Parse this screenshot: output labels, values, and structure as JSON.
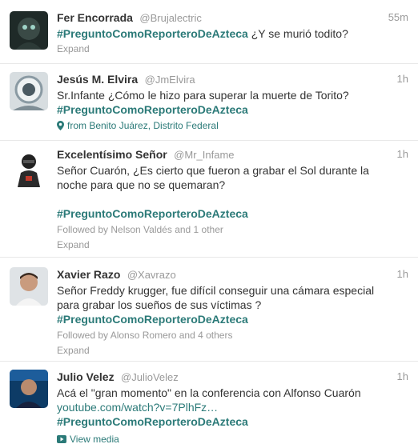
{
  "tweets": [
    {
      "fullname": "Fer Encorrada",
      "username": "@Brujalectric",
      "time": "55m",
      "hashtag": "#PreguntoComoReporteroDeAzteca",
      "text_after": " ¿Y se murió todito?",
      "action": "Expand"
    },
    {
      "fullname": "Jesús M. Elvira",
      "username": "@JmElvira",
      "time": "1h",
      "text_line1": "Sr.Infante ¿Cómo le hizo para superar la muerte de Torito?",
      "hashtag": "#PreguntoComoReporteroDeAzteca",
      "geo": "from Benito Juárez, Distrito Federal"
    },
    {
      "fullname": "Excelentísimo Señor",
      "username": "@Mr_Infame",
      "time": "1h",
      "text_line1": "Señor Cuarón, ¿Es cierto que fueron a grabar el Sol durante la",
      "text_line2": "noche para que no se quemaran?",
      "hashtag": "#PreguntoComoReporteroDeAzteca",
      "followed_by": "Followed by Nelson Valdés and 1 other",
      "action": "Expand"
    },
    {
      "fullname": "Xavier Razo",
      "username": "@Xavrazo",
      "time": "1h",
      "text_line1": "Señor Freddy krugger, fue difícil conseguir una cámara especial",
      "text_line2": "para grabar los sueños de sus víctimas ?",
      "hashtag": "#PreguntoComoReporteroDeAzteca",
      "followed_by": "Followed by Alonso Romero and 4 others",
      "action": "Expand"
    },
    {
      "fullname": "Julio Velez",
      "username": "@JulioVelez",
      "time": "1h",
      "text_line1": "Acá el \"gran momento\" en la conferencia con Alfonso Cuarón",
      "link": "youtube.com/watch?v=7PlhFz…",
      "hashtag": "#PreguntoComoReporteroDeAzteca",
      "action": "View media"
    }
  ],
  "colors": {
    "link": "#2b7a78",
    "text": "#333333",
    "muted": "#999999",
    "divider": "#e8e8e8"
  },
  "icons": [
    "map-pin-icon",
    "media-icon"
  ]
}
